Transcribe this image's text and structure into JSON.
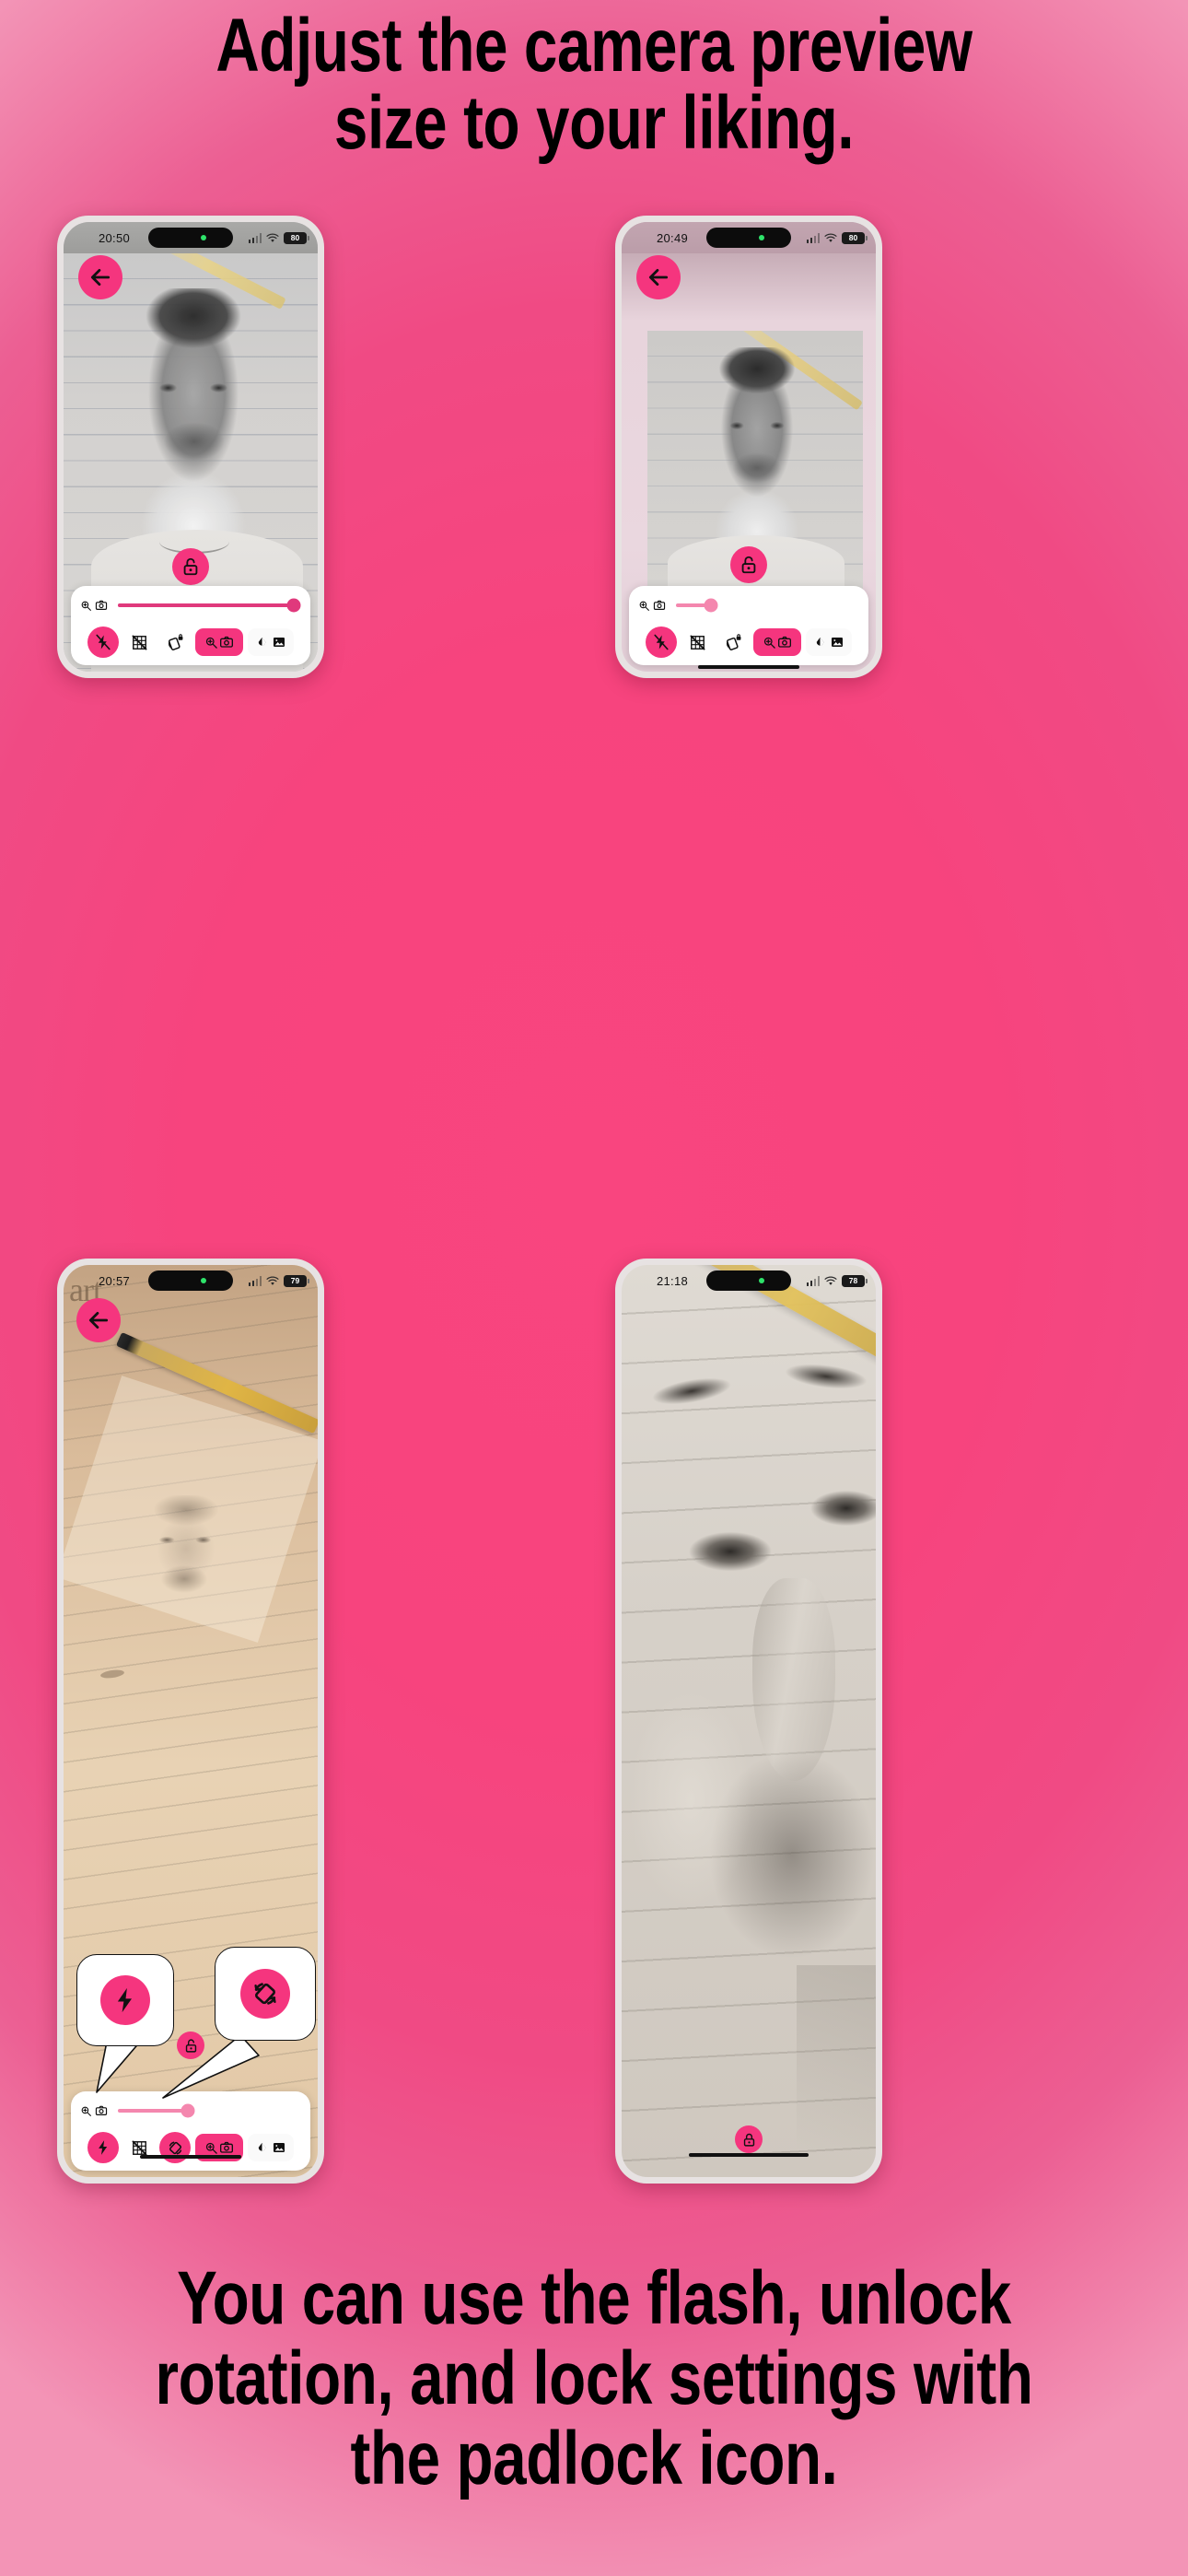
{
  "headline": {
    "line1": "Adjust the camera preview",
    "line2": "size to your liking."
  },
  "footer": {
    "line1": "You can use the flash, unlock",
    "line2": "rotation, and lock settings with",
    "line3": "the padlock icon."
  },
  "colors": {
    "background_pink": "#f9427d",
    "accent_pink": "#f5357e",
    "slider_pink": "#e0397c",
    "slider_light_pink": "#f487ae",
    "text_black": "#000000",
    "panel_white": "#ffffff",
    "status_dot_green": "#2ee36a"
  },
  "phones": [
    {
      "id": "phone-1",
      "status": {
        "time": "20:50",
        "battery": "80",
        "wifi": "wifi-icon",
        "signal": "signal-icon",
        "island_dot": true
      },
      "back_button": "back-arrow-icon",
      "preview_label": "camera-preview-fullscreen",
      "lock": {
        "state": "unlocked",
        "icon": "unlock-icon"
      },
      "slider": {
        "value_percent": 100,
        "left_icon": "zoom-camera-icon"
      },
      "toolbar": [
        {
          "name": "flash-off",
          "icon": "flash-off-icon",
          "active": true,
          "style": "circle"
        },
        {
          "name": "grid-off",
          "icon": "grid-off-icon",
          "active": false,
          "style": "plain"
        },
        {
          "name": "rotation-lock",
          "icon": "rotation-lock-icon",
          "active": false,
          "style": "plain"
        },
        {
          "name": "preview-size",
          "icon": "zoom-camera-icon",
          "active": true,
          "style": "pill"
        },
        {
          "name": "opacity-gallery",
          "icon": "opacity-image-icon",
          "active": false,
          "style": "group"
        }
      ],
      "home_bar": false
    },
    {
      "id": "phone-2",
      "status": {
        "time": "20:49",
        "battery": "80",
        "wifi": "wifi-icon",
        "signal": "signal-icon",
        "island_dot": true
      },
      "back_button": "back-arrow-icon",
      "preview_label": "camera-preview-small",
      "lock": {
        "state": "unlocked",
        "icon": "unlock-icon"
      },
      "slider": {
        "value_percent": 20,
        "left_icon": "zoom-camera-icon"
      },
      "toolbar": [
        {
          "name": "flash-off",
          "icon": "flash-off-icon",
          "active": true,
          "style": "circle"
        },
        {
          "name": "grid-off",
          "icon": "grid-off-icon",
          "active": false,
          "style": "plain"
        },
        {
          "name": "rotation-lock",
          "icon": "rotation-lock-icon",
          "active": false,
          "style": "plain"
        },
        {
          "name": "preview-size",
          "icon": "zoom-camera-icon",
          "active": true,
          "style": "pill"
        },
        {
          "name": "opacity-gallery",
          "icon": "opacity-image-icon",
          "active": false,
          "style": "group"
        }
      ],
      "home_bar": true
    },
    {
      "id": "phone-3",
      "status": {
        "time": "20:57",
        "battery": "79",
        "wifi": "wifi-icon",
        "signal": "signal-icon",
        "island_dot": true
      },
      "back_button": "back-arrow-icon",
      "preview_label": "camera-preview-pencil-sketch",
      "watermark": "art",
      "lock": {
        "state": "unlocked",
        "icon": "unlock-icon"
      },
      "slider": {
        "value_percent": 40,
        "left_icon": "zoom-camera-icon"
      },
      "toolbar": [
        {
          "name": "flash-on",
          "icon": "flash-on-icon",
          "active": true,
          "style": "circle"
        },
        {
          "name": "grid-off",
          "icon": "grid-off-icon",
          "active": false,
          "style": "plain"
        },
        {
          "name": "rotation-unlock",
          "icon": "rotation-unlock-icon",
          "active": true,
          "style": "circle"
        },
        {
          "name": "preview-size",
          "icon": "zoom-camera-icon",
          "active": true,
          "style": "pill"
        },
        {
          "name": "opacity-gallery",
          "icon": "opacity-image-icon",
          "active": false,
          "style": "group"
        }
      ],
      "callouts": [
        {
          "name": "flash-callout",
          "icon": "flash-on-icon"
        },
        {
          "name": "rotation-callout",
          "icon": "rotation-unlock-icon"
        }
      ],
      "home_bar": true
    },
    {
      "id": "phone-4",
      "status": {
        "time": "21:18",
        "battery": "78",
        "wifi": "wifi-icon",
        "signal": "signal-icon",
        "island_dot": true
      },
      "preview_label": "camera-preview-zoomed-face",
      "lock": {
        "state": "locked",
        "icon": "lock-icon"
      },
      "home_bar": true
    }
  ]
}
